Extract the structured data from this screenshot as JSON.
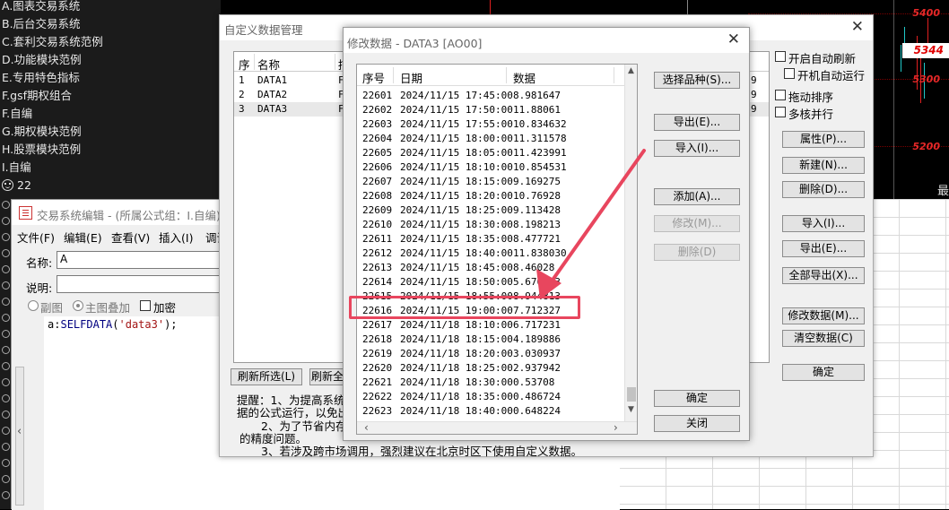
{
  "left_menu": {
    "items": [
      "A.图表交易系统",
      "B.后台交易系统",
      "C.套利交易系统范例",
      "D.功能模块范例",
      "E.专用特色指标",
      "F.gsf期权组合",
      "F.自编",
      "G.期权模块范例",
      "H.股票模块范例",
      "I.自编"
    ],
    "user_count": "22"
  },
  "chart": {
    "prices": [
      "5400",
      "5344",
      "5300",
      "5200"
    ],
    "right_edge_label": "最",
    "accent": "#e62828"
  },
  "editor": {
    "title": "交易系统编辑 - (所属公式组：I.自编)",
    "menus": [
      "文件(F)",
      "编辑(E)",
      "查看(V)",
      "插入(I)",
      "调试"
    ],
    "name_label": "名称:",
    "name_value": "A",
    "desc_label": "说明:",
    "desc_value": "",
    "radio_sub": "副图",
    "radio_main": "主图叠加",
    "encrypt_label": "加密",
    "code_var": "a",
    "code_colon": ":",
    "code_func": "SELFDATA",
    "code_open": "(",
    "code_str": "'data3'",
    "code_close": ");"
  },
  "manager": {
    "title": "自定义数据管理",
    "columns": [
      "序",
      "名称",
      "描"
    ],
    "rows": [
      {
        "seq": "1",
        "name": "DATA1",
        "desc": "F",
        "tail": "9"
      },
      {
        "seq": "2",
        "name": "DATA2",
        "desc": "F",
        "tail": "9"
      },
      {
        "seq": "3",
        "name": "DATA3",
        "desc": "F",
        "tail": "9"
      }
    ],
    "auto_refresh": "开启自动刷新",
    "auto_run": "开机自动运行",
    "drag_sort": "拖动排序",
    "multi_core": "多核并行",
    "buttons": {
      "props": "属性(P)...",
      "new": "新建(N)...",
      "delete": "删除(D)...",
      "import": "导入(I)...",
      "export": "导出(E)...",
      "export_all": "全部导出(X)...",
      "modify": "修改数据(M)...",
      "clear": "清空数据(C)",
      "ok": "确定",
      "refresh_sel": "刷新所选(L)",
      "refresh_all": "刷新全"
    },
    "tips": [
      "提醒：1、为提高系统稳",
      "据的公式运行，以免出",
      "2、为了节省内存",
      "的精度问题。",
      "3、若涉及跨市场调用，强烈建议在北京时区下使用自定义数据。"
    ]
  },
  "modify": {
    "title": "修改数据 - DATA3 [AO00]",
    "columns": [
      "序号",
      "日期",
      "数据"
    ],
    "rows": [
      {
        "seq": "22601",
        "date": "2024/11/15 17:45:00",
        "value": "8.981647"
      },
      {
        "seq": "22602",
        "date": "2024/11/15 17:50:00",
        "value": "11.88061"
      },
      {
        "seq": "22603",
        "date": "2024/11/15 17:55:00",
        "value": "10.834632"
      },
      {
        "seq": "22604",
        "date": "2024/11/15 18:00:00",
        "value": "11.311578"
      },
      {
        "seq": "22605",
        "date": "2024/11/15 18:05:00",
        "value": "11.423991"
      },
      {
        "seq": "22606",
        "date": "2024/11/15 18:10:00",
        "value": "10.854531"
      },
      {
        "seq": "22607",
        "date": "2024/11/15 18:15:00",
        "value": "9.169275"
      },
      {
        "seq": "22608",
        "date": "2024/11/15 18:20:00",
        "value": "10.76928"
      },
      {
        "seq": "22609",
        "date": "2024/11/15 18:25:00",
        "value": "9.113428"
      },
      {
        "seq": "22610",
        "date": "2024/11/15 18:30:00",
        "value": "8.198213"
      },
      {
        "seq": "22611",
        "date": "2024/11/15 18:35:00",
        "value": "8.477721"
      },
      {
        "seq": "22612",
        "date": "2024/11/15 18:40:00",
        "value": "11.838030"
      },
      {
        "seq": "22613",
        "date": "2024/11/15 18:45:00",
        "value": "8.46028"
      },
      {
        "seq": "22614",
        "date": "2024/11/15 18:50:00",
        "value": "5.670533"
      },
      {
        "seq": "22615",
        "date": "2024/11/15 18:55:00",
        "value": "8.944813"
      },
      {
        "seq": "22616",
        "date": "2024/11/15 19:00:00",
        "value": "7.712327"
      },
      {
        "seq": "22617",
        "date": "2024/11/18 18:10:00",
        "value": "6.717231"
      },
      {
        "seq": "22618",
        "date": "2024/11/18 18:15:00",
        "value": "4.189886"
      },
      {
        "seq": "22619",
        "date": "2024/11/18 18:20:00",
        "value": "3.030937"
      },
      {
        "seq": "22620",
        "date": "2024/11/18 18:25:00",
        "value": "2.937942"
      },
      {
        "seq": "22621",
        "date": "2024/11/18 18:30:00",
        "value": "0.53708"
      },
      {
        "seq": "22622",
        "date": "2024/11/18 18:35:00",
        "value": "0.486724"
      },
      {
        "seq": "22623",
        "date": "2024/11/18 18:40:00",
        "value": "0.648224"
      }
    ],
    "buttons": {
      "select_symbol": "选择品种(S)...",
      "export": "导出(E)...",
      "import": "导入(I)...",
      "add": "添加(A)...",
      "modify": "修改(M)...",
      "delete": "删除(D)",
      "ok": "确定",
      "close": "关闭"
    },
    "highlight_color": "#e8465e"
  }
}
